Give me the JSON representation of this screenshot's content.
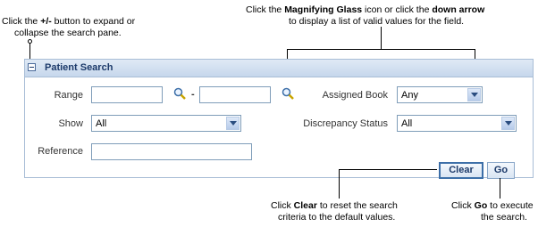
{
  "callouts": {
    "toggle": [
      "Click the ",
      "+/-",
      " button to expand or",
      "collapse the search pane."
    ],
    "magnify": [
      "Click the ",
      "Magnifying Glass",
      " icon or click the ",
      "down arrow",
      "to display a list of valid values for the field."
    ],
    "clear": [
      "Click ",
      "Clear",
      " to reset the search",
      "criteria to the default values."
    ],
    "go": [
      "Click ",
      "Go",
      " to execute",
      "the search."
    ]
  },
  "pane": {
    "title": "Patient Search",
    "range_label": "Range",
    "range_separator": "-",
    "assigned_book_label": "Assigned Book",
    "assigned_book_value": "Any",
    "show_label": "Show",
    "show_value": "All",
    "discrepancy_label": "Discrepancy Status",
    "discrepancy_value": "All",
    "reference_label": "Reference",
    "clear_label": "Clear",
    "go_label": "Go"
  },
  "icons": {
    "toggle": "minus-box-icon",
    "search": "magnifying-glass-icon",
    "dropdown": "chevron-down-icon"
  },
  "colors": {
    "header_gradient_top": "#dfe9f5",
    "header_gradient_bottom": "#c6d7ec",
    "title": "#1c3a6a",
    "border": "#a9bdd6"
  }
}
